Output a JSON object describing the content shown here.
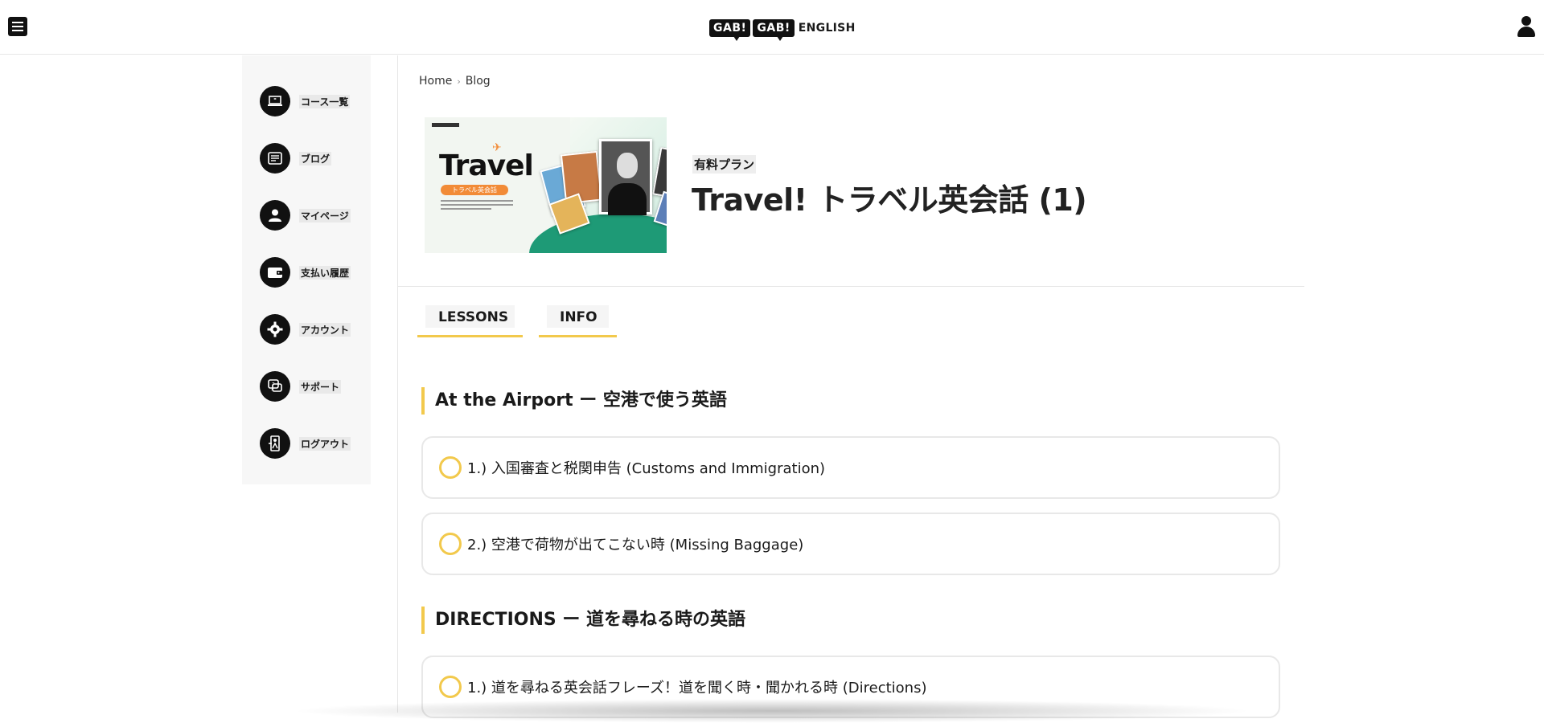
{
  "header": {
    "logo_bubble_1": "GAB!",
    "logo_bubble_2": "GAB!",
    "logo_word": "ENGLISH"
  },
  "sidebar": {
    "items": [
      {
        "label": "コース一覧",
        "icon": "laptop-icon"
      },
      {
        "label": "ブログ",
        "icon": "blog-icon"
      },
      {
        "label": "マイページ",
        "icon": "user-icon"
      },
      {
        "label": "支払い履歴",
        "icon": "wallet-icon"
      },
      {
        "label": "アカウント",
        "icon": "gear-icon"
      },
      {
        "label": "サポート",
        "icon": "support-icon"
      },
      {
        "label": "ログアウト",
        "icon": "logout-icon"
      }
    ]
  },
  "breadcrumb": {
    "home": "Home",
    "separator": "›",
    "current": "Blog"
  },
  "course": {
    "thumbnail_title": "Travel",
    "thumbnail_subtitle": "トラベル英会話",
    "plan": "有料プラン",
    "title": "Travel! トラベル英会話 (1)"
  },
  "tabs": [
    {
      "label": "LESSONS"
    },
    {
      "label": "INFO"
    }
  ],
  "sections": [
    {
      "title": "At the Airport ー 空港で使う英語",
      "lessons": [
        "1.) 入国審査と税関申告 (Customs and Immigration)",
        "2.) 空港で荷物が出てこない時 (Missing Baggage)"
      ]
    },
    {
      "title": "DIRECTIONS ー 道を尋ねる時の英語",
      "lessons": [
        "1.) 道を尋ねる英会話フレーズ！道を聞く時・聞かれる時 (Directions)"
      ]
    }
  ],
  "colors": {
    "accent": "#f2c94c",
    "dark": "#111111",
    "brand_orange": "#f28b37",
    "brand_green": "#1e9a76"
  }
}
